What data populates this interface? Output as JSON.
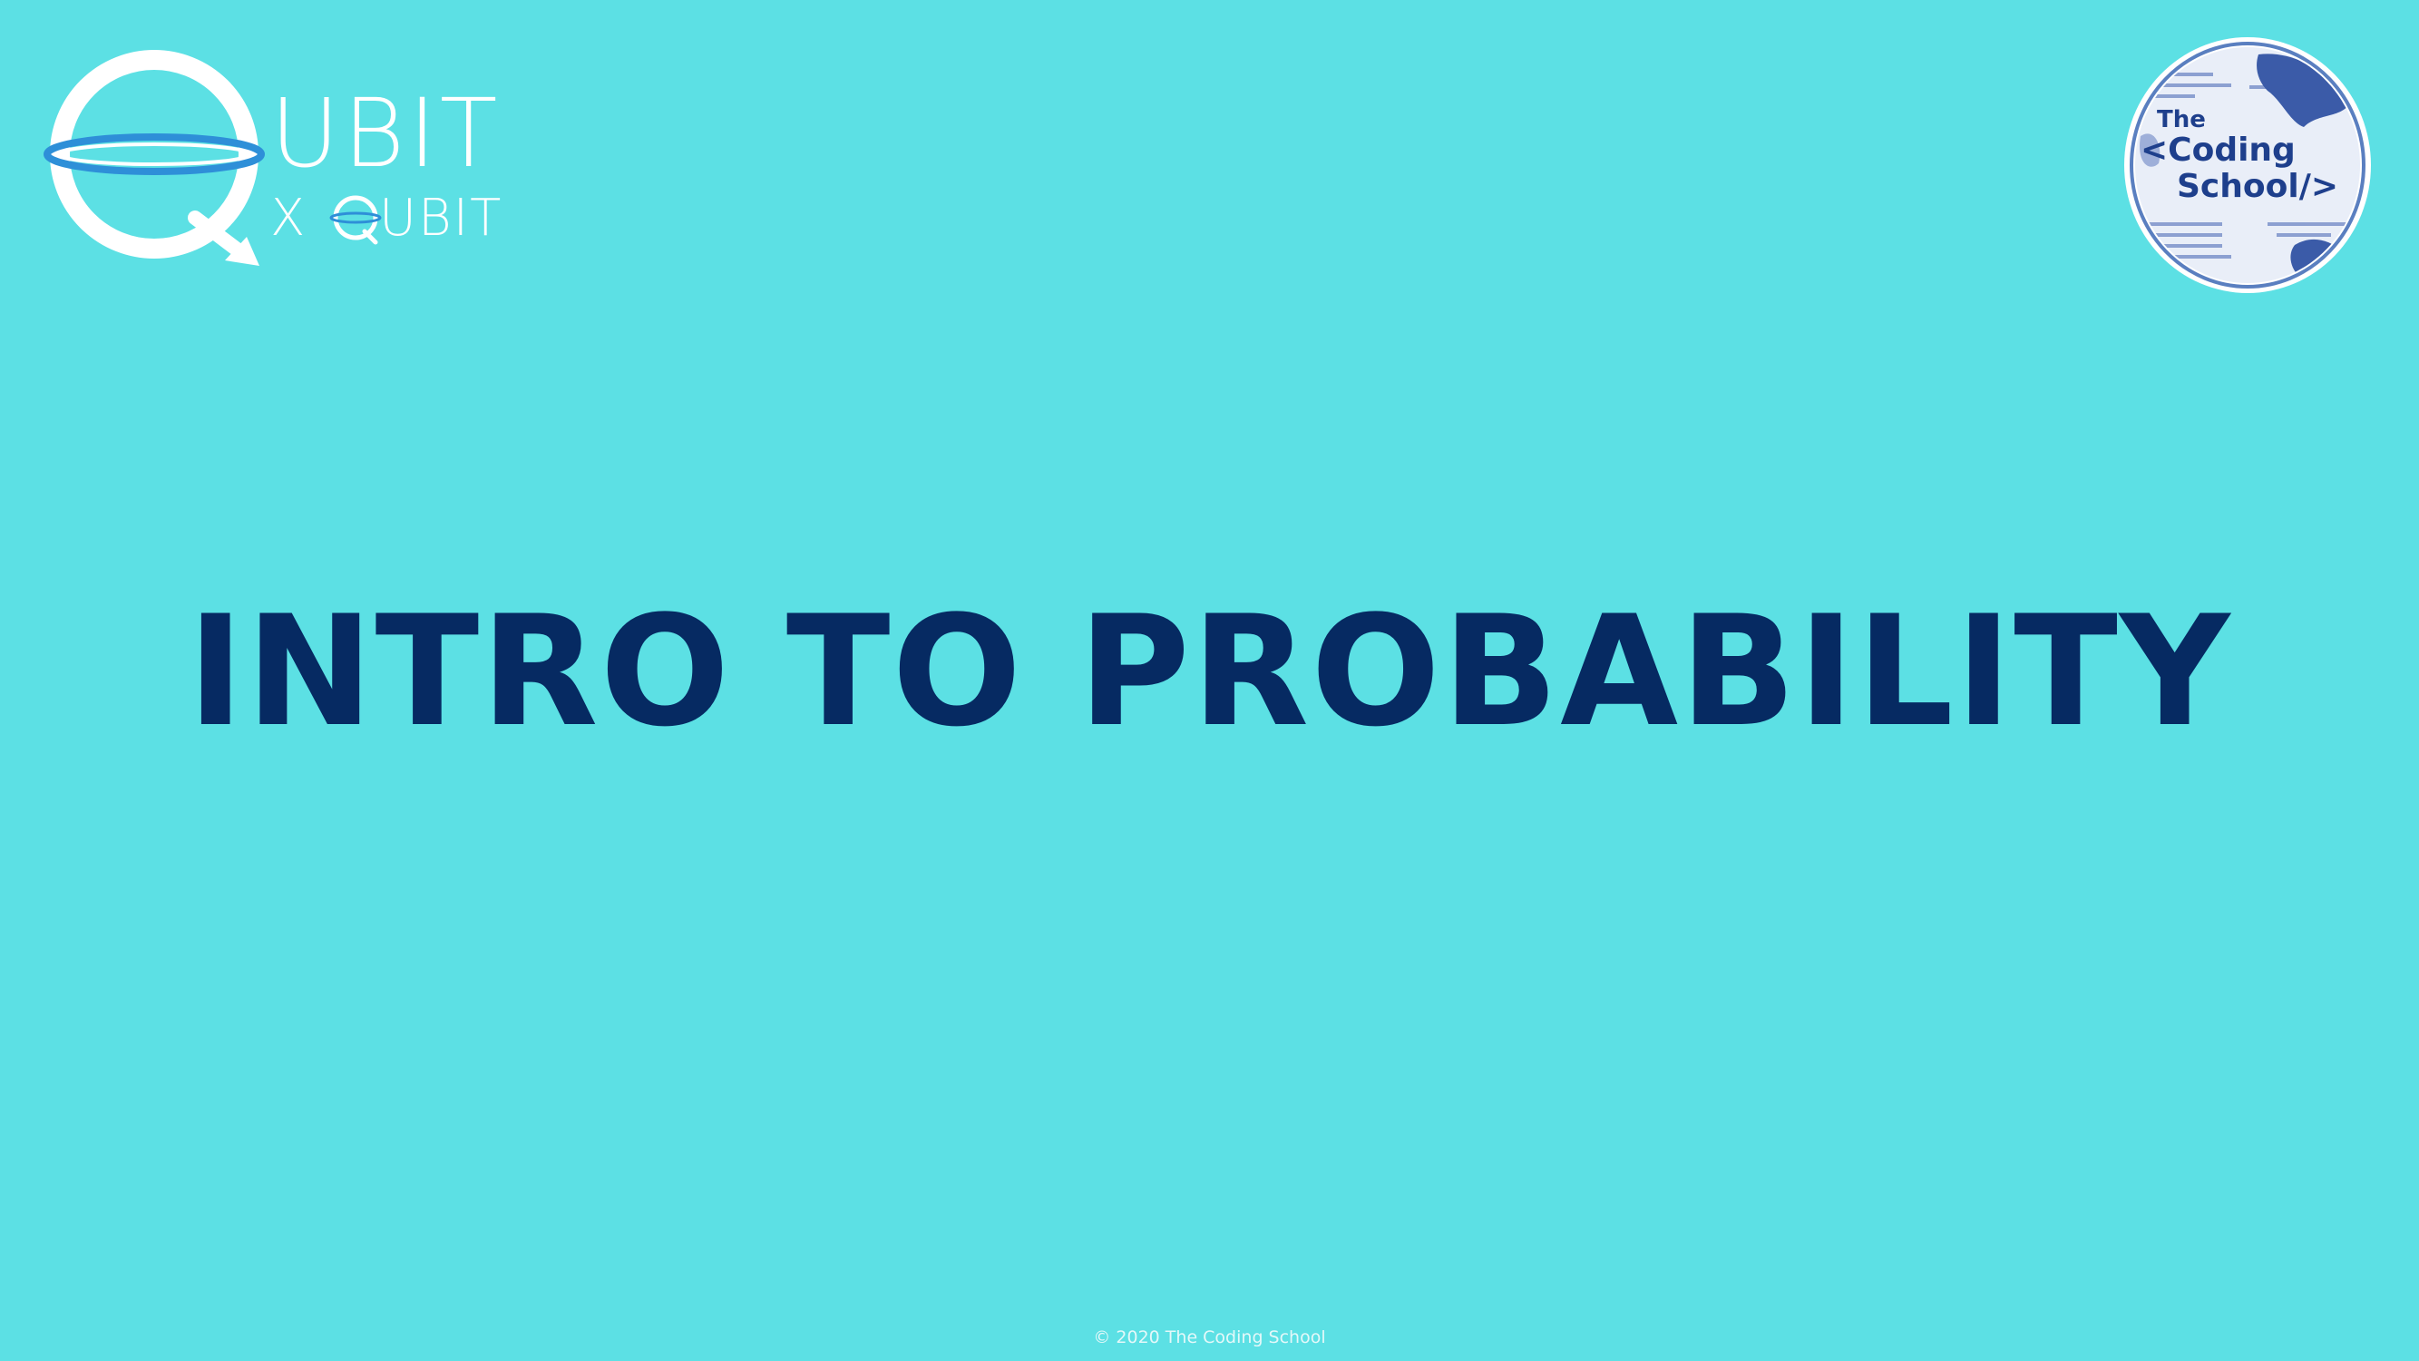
{
  "slide": {
    "title": "INTRO TO PROBABILITY",
    "footer": "© 2020 The Coding School",
    "background_color": "#5ce0e4",
    "title_color": "#062a62"
  },
  "logos": {
    "qubit_x_qubit": {
      "word_main": "UBIT",
      "word_x": "X",
      "word_sub": "UBIT",
      "icon": "qubit-ring-icon"
    },
    "coding_school": {
      "line1": "The",
      "line2": "<Coding",
      "line3": "School/>",
      "icon": "globe-icon"
    }
  }
}
